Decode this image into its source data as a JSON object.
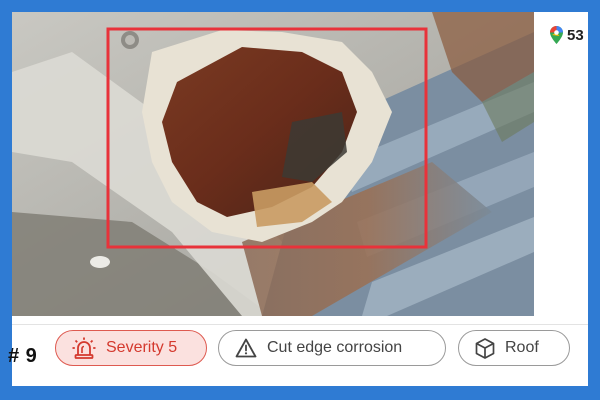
{
  "location": {
    "value": "53",
    "icon": "map-pin-icon"
  },
  "annotation": {
    "color": "#e8323a"
  },
  "finding": {
    "index": "# 9",
    "severity_label": "Severity 5",
    "severity_icon": "alarm-siren-icon",
    "type_label": "Cut edge corrosion",
    "type_icon": "warning-triangle-icon",
    "component_label": "Roof",
    "component_icon": "cube-icon"
  },
  "colors": {
    "frame": "#2f7bd3",
    "severity_text": "#d4392e",
    "severity_bg": "#fbe1df",
    "chip_border": "#9a9a9a"
  }
}
